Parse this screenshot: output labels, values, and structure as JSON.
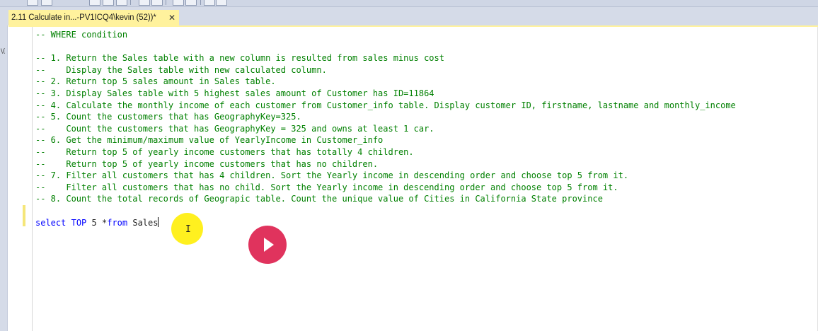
{
  "tab": {
    "title": "2.11 Calculate in...-PV1ICQ4\\kevin (52))*",
    "close_glyph": "✕"
  },
  "editor": {
    "comment_lines": [
      "-- WHERE condition",
      "",
      "-- 1. Return the Sales table with a new column is resulted from sales minus cost",
      "--    Display the Sales table with new calculated column.",
      "-- 2. Return top 5 sales amount in Sales table.",
      "-- 3. Display Sales table with 5 highest sales amount of Customer has ID=11864",
      "-- 4. Calculate the monthly income of each customer from Customer_info table. Display customer ID, firstname, lastname and monthly_income",
      "-- 5. Count the customers that has GeographyKey=325.",
      "--    Count the customers that has GeographyKey = 325 and owns at least 1 car.",
      "-- 6. Get the minimum/maximum value of YearlyIncome in Customer_info",
      "--    Return top 5 of yearly income customers that has totally 4 children.",
      "--    Return top 5 of yearly income customers that has no children.",
      "-- 7. Filter all customers that has 4 children. Sort the Yearly income in descending order and choose top 5 from it.",
      "--    Filter all customers that has no child. Sort the Yearly income in descending order and choose top 5 from it.",
      "-- 8. Count the total records of Geograpic table. Count the unique value of Cities in California State province"
    ],
    "query": {
      "kw_select": "select",
      "kw_top": "TOP",
      "number": "5",
      "star": "*",
      "kw_from": "from",
      "table": "Sales"
    }
  },
  "overlays": {
    "cursor_text": "I",
    "play_icon": "play-icon",
    "halo_color": "#ffee00",
    "play_color": "#e0335d"
  },
  "colors": {
    "comment": "#008000",
    "keyword": "#0000ff",
    "tab_active": "#fff29d"
  }
}
